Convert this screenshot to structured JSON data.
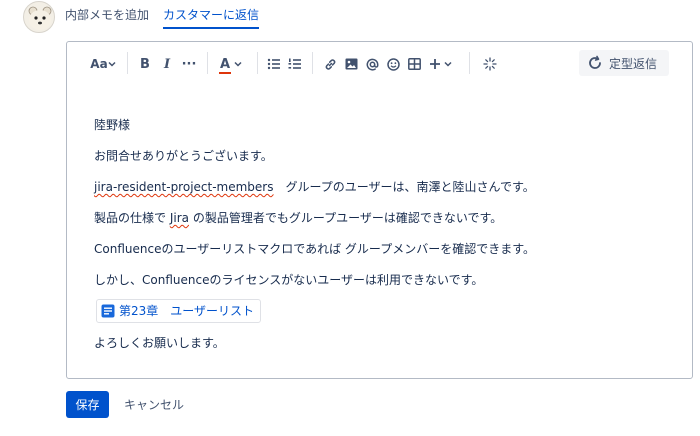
{
  "tabs": {
    "internal_note": "内部メモを追加",
    "reply_customer": "カスタマーに返信"
  },
  "toolbar": {
    "text_style": "Aa",
    "bold": "B",
    "italic": "I",
    "more": "···",
    "text_color": "A",
    "quick_reply": "定型返信"
  },
  "content": {
    "line1": "陸野様",
    "line2": "お問合せありがとうございます。",
    "line3_link": "jira-resident-project-members",
    "line3_rest": "　グループのユーザーは、南澤と陸山さんです。",
    "line4_a": "製品の仕様で ",
    "line4_jira": "Jira",
    "line4_b": " の製品管理者でもグループユーザーは確認できないです。",
    "line5": "Confluenceのユーザーリストマクロであれば グループメンバーを確認できます。",
    "line6": "しかし、Confluenceのライセンスがないユーザーは利用できないです。",
    "page_link": "第23章　ユーザーリスト",
    "line8": "よろしくお願いします。"
  },
  "footer": {
    "save": "保存",
    "cancel": "キャンセル"
  },
  "colors": {
    "accent": "#0052cc",
    "spell_error": "#de350b"
  },
  "icons": [
    "avatar",
    "chevron-down-icon",
    "bullet-list-icon",
    "numbered-list-icon",
    "link-icon",
    "image-icon",
    "mention-icon",
    "emoji-icon",
    "table-icon",
    "plus-icon",
    "ai-sparkle-icon",
    "quick-reply-icon",
    "page-icon"
  ]
}
